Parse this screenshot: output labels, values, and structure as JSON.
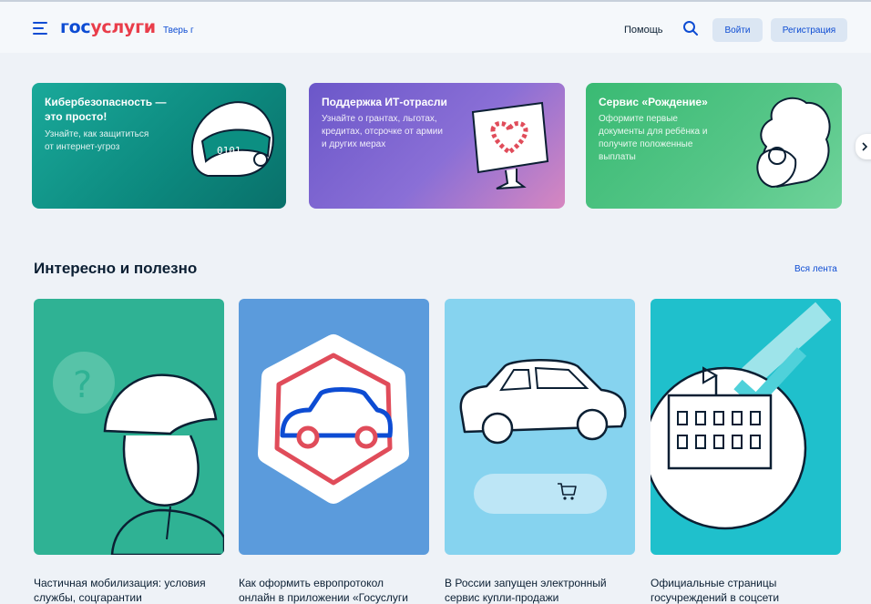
{
  "header": {
    "logo_part1": "гос",
    "logo_part2": "услуги",
    "city": "Тверь г",
    "help": "Помощь",
    "login": "Войти",
    "register": "Регистрация"
  },
  "banners": [
    {
      "title_line1": "Кибербезопасность —",
      "title_line2": "это просто!",
      "text_line1": "Узнайте, как защититься",
      "text_line2": "от интернет-угроз"
    },
    {
      "title": "Поддержка ИТ-отрасли",
      "text_line1": "Узнайте о грантах, льготах,",
      "text_line2": "кредитах, отсрочке от армии",
      "text_line3": "и других мерах"
    },
    {
      "title": "Сервис «Рождение»",
      "text_line1": "Оформите первые",
      "text_line2": "документы для ребёнка и",
      "text_line3": "получите положенные",
      "text_line4": "выплаты"
    }
  ],
  "feed": {
    "title": "Интересно и полезно",
    "all_link": "Вся лента",
    "cards": [
      {
        "title_line1": "Частичная мобилизация: условия",
        "title_line2": "службы, соцгарантии"
      },
      {
        "title_line1": "Как оформить европротокол",
        "title_line2": "онлайн в приложении «Госуслуги"
      },
      {
        "title_line1": "В России запущен электронный",
        "title_line2": "сервис купли-продажи"
      },
      {
        "title_line1": "Официальные страницы",
        "title_line2": "госучреждений в соцсети"
      }
    ]
  },
  "icons": [
    "menu-icon",
    "search-icon",
    "chevron-right-icon",
    "cart-icon"
  ],
  "colors": {
    "brand_blue": "#0d4cd3",
    "brand_red": "#e93d4a",
    "background": "#eef2f7"
  }
}
